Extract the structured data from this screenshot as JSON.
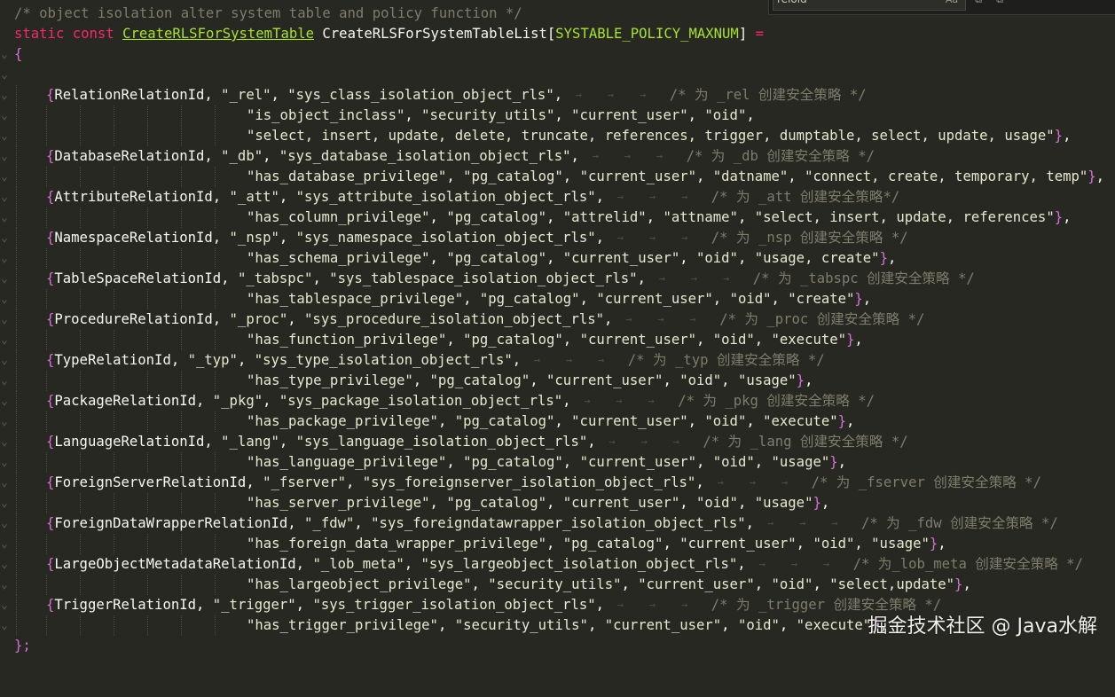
{
  "find_widget": {
    "query": "relold",
    "case_label": "Aa"
  },
  "code": {
    "comment_header": "/* object isolation alter system table and policy function */",
    "decl_kw1": "static",
    "decl_kw2": "const",
    "decl_type": "CreateRLSForSystemTable",
    "decl_name": "CreateRLSForSystemTableList",
    "decl_macro": "SYSTABLE_POLICY_MAXNUM",
    "decl_tail": " =",
    "open_brace": "{",
    "close": "};",
    "entries": [
      {
        "l1": "RelationRelationId, \"_rel\", \"sys_class_isolation_object_rls\",",
        "c": "/* 为 _rel 创建安全策略 */",
        "more": [
          "\"is_object_inclass\", \"security_utils\", \"current_user\", \"oid\",",
          "\"select, insert, update, delete, truncate, references, trigger, dumptable, select, update, usage\"},"
        ]
      },
      {
        "l1": "DatabaseRelationId, \"_db\", \"sys_database_isolation_object_rls\",",
        "c": "/* 为 _db 创建安全策略 */",
        "more": [
          "\"has_database_privilege\", \"pg_catalog\", \"current_user\", \"datname\", \"connect, create, temporary, temp\"},"
        ]
      },
      {
        "l1": "AttributeRelationId, \"_att\", \"sys_attribute_isolation_object_rls\",",
        "c": "/* 为 _att 创建安全策略*/",
        "more": [
          "\"has_column_privilege\", \"pg_catalog\", \"attrelid\", \"attname\", \"select, insert, update, references\"},"
        ]
      },
      {
        "l1": "NamespaceRelationId, \"_nsp\", \"sys_namespace_isolation_object_rls\",",
        "c": "/* 为 _nsp 创建安全策略 */",
        "more": [
          "\"has_schema_privilege\", \"pg_catalog\", \"current_user\", \"oid\", \"usage, create\"},"
        ]
      },
      {
        "l1": "TableSpaceRelationId, \"_tabspc\", \"sys_tablespace_isolation_object_rls\",",
        "c": "/* 为 _tabspc 创建安全策略 */",
        "more": [
          "\"has_tablespace_privilege\", \"pg_catalog\", \"current_user\", \"oid\", \"create\"},"
        ]
      },
      {
        "l1": "ProcedureRelationId, \"_proc\", \"sys_procedure_isolation_object_rls\",",
        "c": "/* 为 _proc 创建安全策略 */",
        "more": [
          "\"has_function_privilege\", \"pg_catalog\", \"current_user\", \"oid\", \"execute\"},"
        ]
      },
      {
        "l1": "TypeRelationId, \"_typ\", \"sys_type_isolation_object_rls\",",
        "c": "/* 为 _typ 创建安全策略 */",
        "more": [
          "\"has_type_privilege\", \"pg_catalog\", \"current_user\", \"oid\", \"usage\"},"
        ]
      },
      {
        "l1": "PackageRelationId, \"_pkg\", \"sys_package_isolation_object_rls\",",
        "c": "/* 为 _pkg 创建安全策略 */",
        "more": [
          "\"has_package_privilege\", \"pg_catalog\", \"current_user\", \"oid\", \"execute\"},"
        ]
      },
      {
        "l1": "LanguageRelationId, \"_lang\", \"sys_language_isolation_object_rls\",",
        "c": "/* 为 _lang 创建安全策略 */",
        "more": [
          "\"has_language_privilege\", \"pg_catalog\", \"current_user\", \"oid\", \"usage\"},"
        ]
      },
      {
        "l1": "ForeignServerRelationId, \"_fserver\", \"sys_foreignserver_isolation_object_rls\",",
        "c": "/* 为 _fserver 创建安全策略 */",
        "more": [
          "\"has_server_privilege\", \"pg_catalog\", \"current_user\", \"oid\", \"usage\"},"
        ]
      },
      {
        "l1": "ForeignDataWrapperRelationId, \"_fdw\", \"sys_foreigndatawrapper_isolation_object_rls\",",
        "c": "/* 为 _fdw 创建安全策略 */",
        "more": [
          "\"has_foreign_data_wrapper_privilege\", \"pg_catalog\", \"current_user\", \"oid\", \"usage\"},"
        ]
      },
      {
        "l1": "LargeObjectMetadataRelationId, \"_lob_meta\", \"sys_largeobject_isolation_object_rls\",",
        "c": "/* 为_lob_meta 创建安全策略 */",
        "more": [
          "\"has_largeobject_privilege\", \"security_utils\", \"current_user\", \"oid\", \"select,update\"},"
        ]
      },
      {
        "l1": "TriggerRelationId, \"_trigger\", \"sys_trigger_isolation_object_rls\",",
        "c": "/* 为 _trigger 创建安全策略 */",
        "more": [
          "\"has_trigger_privilege\", \"security_utils\", \"current_user\", \"oid\", \"execute\"},"
        ]
      }
    ]
  },
  "watermark": "掘金技术社区 @ Java水解",
  "colors": {
    "background": "#272822",
    "comment": "#7f7c6b",
    "keyword": "#f92672",
    "type": "#a6e22e",
    "bracket": "#d670d6"
  }
}
